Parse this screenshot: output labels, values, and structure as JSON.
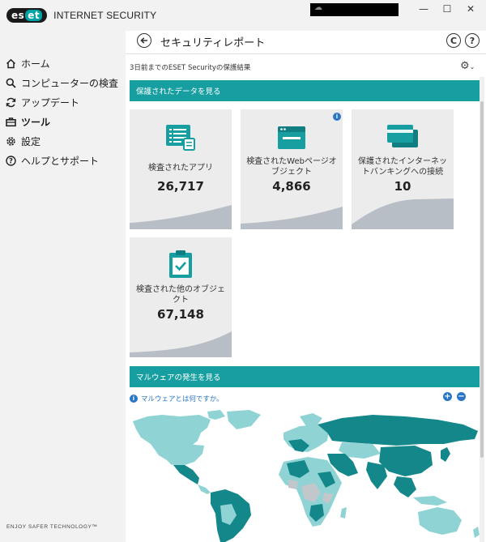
{
  "app": {
    "logo_text": "eset",
    "product_name": "INTERNET SECURITY",
    "tagline": "ENJOY SAFER TECHNOLOGY™"
  },
  "window_controls": {
    "minimize": "—",
    "maximize": "☐",
    "close": "✕"
  },
  "sidebar": {
    "items": [
      {
        "label": "ホーム",
        "icon": "home-icon",
        "active": false
      },
      {
        "label": "コンピューターの検査",
        "icon": "search-icon",
        "active": false
      },
      {
        "label": "アップデート",
        "icon": "refresh-icon",
        "active": false
      },
      {
        "label": "ツール",
        "icon": "briefcase-icon",
        "active": true
      },
      {
        "label": "設定",
        "icon": "gear-icon",
        "active": false
      },
      {
        "label": "ヘルプとサポート",
        "icon": "help-icon",
        "active": false
      }
    ]
  },
  "header": {
    "title": "セキュリティレポート",
    "subtitle": "3日前までのESET Securityの保護結果"
  },
  "sections": {
    "protected_data": "保護されたデータを見る",
    "malware": "マルウェアの発生を見る",
    "malware_link": "マルウェアとは何ですか。"
  },
  "tiles": [
    {
      "label": "検査されたアプリ",
      "value": "26,717",
      "icon": "app-list-icon"
    },
    {
      "label": "検査されたWebページオブジェクト",
      "value": "4,866",
      "icon": "browser-window-icon"
    },
    {
      "label": "保護されたインターネットバンキングへの接続",
      "value": "10",
      "icon": "credit-card-icon"
    },
    {
      "label": "検査された他のオブジェクト",
      "value": "67,148",
      "icon": "clipboard-check-icon"
    }
  ],
  "colors": {
    "accent": "#169ea0",
    "map_dark": "#13878a",
    "map_light": "#8fd3d4",
    "map_gray": "#c2c7cc",
    "curve": "#b8bec6",
    "link": "#2a76c6"
  }
}
